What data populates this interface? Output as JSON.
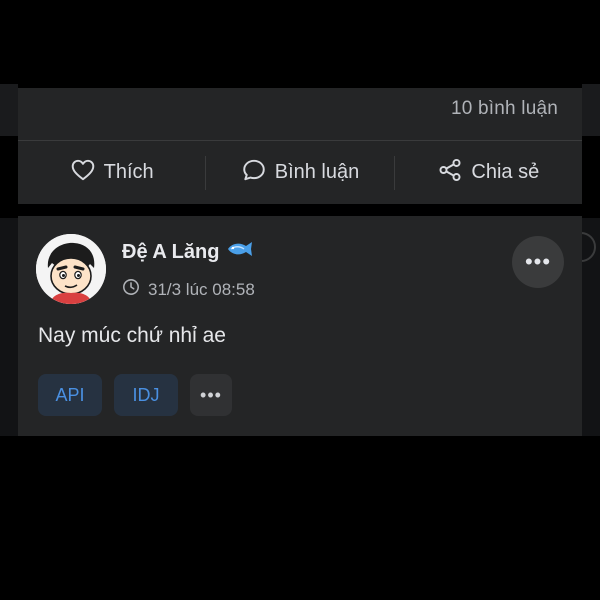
{
  "stats": {
    "comments_label": "10 bình luận"
  },
  "actions": [
    {
      "label": "Thích",
      "icon": "heart-icon"
    },
    {
      "label": "Bình luận",
      "icon": "comment-icon"
    },
    {
      "label": "Chia sẻ",
      "icon": "share-icon"
    }
  ],
  "post": {
    "author": "Đệ A Lăng",
    "author_badge_icon": "fish-icon",
    "timestamp": "31/3 lúc 08:58",
    "timestamp_icon": "clock-icon",
    "text": "Nay múc chứ nhỉ ae",
    "more_label": "•••",
    "tags": [
      "API",
      "IDJ"
    ],
    "tags_more_label": "•••"
  },
  "colors": {
    "background": "#000000",
    "card": "#242526",
    "text_primary": "#e4e6eb",
    "text_secondary": "#b0b3b8",
    "tag_text": "#4a90e2",
    "tag_bg": "#263241"
  }
}
